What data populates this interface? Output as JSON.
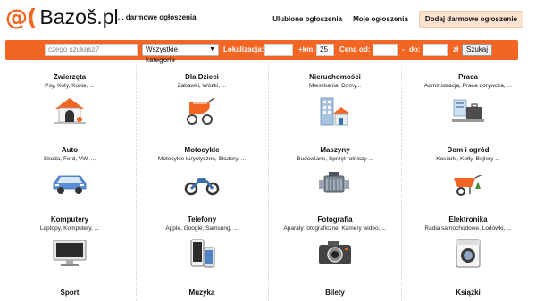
{
  "header": {
    "logo_at": "@(",
    "logo_text": "Bazoš.pl",
    "tagline": "... darmowe ogłoszenia",
    "nav": [
      {
        "label": "Ulubione ogłoszenia"
      },
      {
        "label": "Moje ogłoszenia"
      },
      {
        "label": "Dodaj darmowe ogłoszenie"
      }
    ]
  },
  "search": {
    "query_placeholder": "czego szukasz?",
    "category_selected": "Wszystkie kategorie",
    "location_label": "Lokalizacja:",
    "location_value": "",
    "km_label": "+km:",
    "km_value": "25",
    "price_label": "Cena",
    "from_label": "od:",
    "from_value": "",
    "to_label": "do:",
    "to_value": "",
    "currency": "zł",
    "submit_label": "Szukaj"
  },
  "categories": [
    {
      "title": "Zwierzęta",
      "sub": "Psy, Koty, Konie, ...",
      "icon": "doghouse-icon"
    },
    {
      "title": "Dla Dzieci",
      "sub": "Zabawki, Wózki, ...",
      "icon": "baby-stroller-icon"
    },
    {
      "title": "Nieruchomości",
      "sub": "Mieszkania, Domy...",
      "icon": "buildings-icon"
    },
    {
      "title": "Praca",
      "sub": "Administracja, Praca dorywcza, ...",
      "icon": "office-desk-icon"
    },
    {
      "title": "Auto",
      "sub": "Škoda, Ford, VW, ...",
      "icon": "car-icon"
    },
    {
      "title": "Motocykle",
      "sub": "Motocykle turystyczne, Skutery, ...",
      "icon": "motorcycle-icon"
    },
    {
      "title": "Maszyny",
      "sub": "Budowlane, Sprzęt rolniczy ...",
      "icon": "engine-icon"
    },
    {
      "title": "Dom i ogród",
      "sub": "Kosiarki, Kotły, Bojlery ...",
      "icon": "wheelbarrow-icon"
    },
    {
      "title": "Komputery",
      "sub": "Laptopy, Komputery, ...",
      "icon": "monitor-icon"
    },
    {
      "title": "Telefony",
      "sub": "Apple, Google, Samsung, ...",
      "icon": "phones-icon"
    },
    {
      "title": "Fotografia",
      "sub": "Aparaty fotograficzne, Kamery wideo, ...",
      "icon": "camera-icon"
    },
    {
      "title": "Elektronika",
      "sub": "Radia samochodowe, Lodówki, ...",
      "icon": "washing-machine-icon"
    },
    {
      "title": "Sport",
      "sub": "",
      "icon": ""
    },
    {
      "title": "Muzyka",
      "sub": "",
      "icon": ""
    },
    {
      "title": "Bilety",
      "sub": "",
      "icon": ""
    },
    {
      "title": "Książki",
      "sub": "",
      "icon": ""
    }
  ],
  "colors": {
    "brand_orange": "#f26522",
    "highlight_bg": "#fde3cf"
  }
}
